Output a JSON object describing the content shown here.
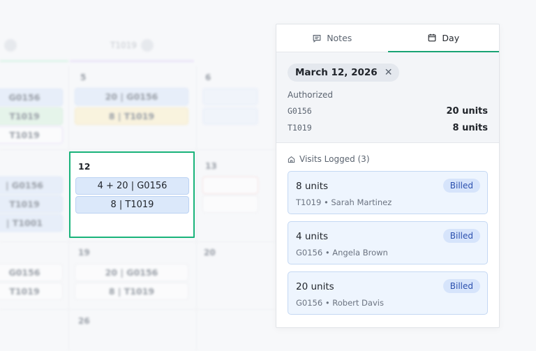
{
  "calendar": {
    "header_pills": [
      "",
      "T1019"
    ],
    "cells": [
      {
        "day": "5",
        "chips": [
          "20 | G0156",
          "8 | T1019"
        ]
      },
      {
        "day": "6",
        "chips": []
      },
      {
        "day": "13",
        "chips": []
      },
      {
        "day": "19",
        "chips": [
          "20 | G0156",
          "8 | T1019"
        ]
      },
      {
        "day": "20",
        "chips": []
      },
      {
        "day": "26",
        "chips": []
      }
    ],
    "left_column_chips": [
      "G0156",
      "T1019",
      "T1019",
      "| G0156",
      "T1019",
      "| T1001",
      "G0156",
      "T1019"
    ],
    "selected": {
      "day": "12",
      "chips": [
        "4 + 20 | G0156",
        "8 | T1019"
      ]
    }
  },
  "panel": {
    "tabs": [
      {
        "label": "Notes",
        "icon": "message-icon",
        "active": false
      },
      {
        "label": "Day",
        "icon": "calendar-icon",
        "active": true
      }
    ],
    "date": "March 12, 2026",
    "authorized": {
      "title": "Authorized",
      "rows": [
        {
          "code": "G0156",
          "units": "20 units"
        },
        {
          "code": "T1019",
          "units": "8 units"
        }
      ]
    },
    "visits_title": "Visits Logged (3)",
    "visits": [
      {
        "units": "8 units",
        "code": "T1019",
        "person": "Sarah Martinez",
        "status": "Billed",
        "sub": "T1019 • Sarah Martinez"
      },
      {
        "units": "4 units",
        "code": "G0156",
        "person": "Angela Brown",
        "status": "Billed",
        "sub": "G0156 • Angela Brown"
      },
      {
        "units": "20 units",
        "code": "G0156",
        "person": "Robert Davis",
        "status": "Billed",
        "sub": "G0156 • Robert Davis"
      }
    ],
    "colors": {
      "accent": "#19a374",
      "selected_border": "#19b37a",
      "badge_text": "#2b4fae",
      "badge_bg": "#d6e4fb"
    }
  }
}
